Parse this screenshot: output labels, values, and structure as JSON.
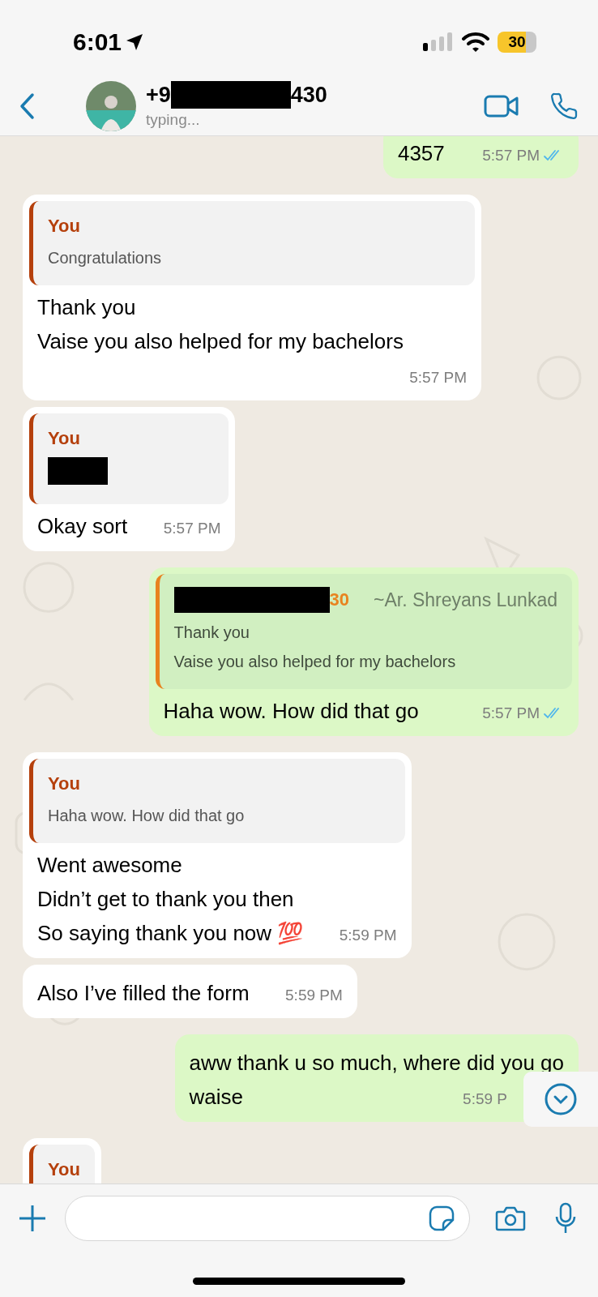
{
  "status_bar": {
    "time": "6:01",
    "battery": "30"
  },
  "header": {
    "title_start": "+9",
    "title_end": "430",
    "subtitle": "typing..."
  },
  "messages": [
    {
      "kind": "outgoing",
      "lines": [
        "4357"
      ],
      "time": "5:57 PM",
      "read": true
    },
    {
      "kind": "incoming",
      "quote": {
        "author": "You",
        "lines": [
          "Congratulations"
        ]
      },
      "lines": [
        "Thank you",
        "Vaise you also helped for my bachelors"
      ],
      "time": "5:57 PM"
    },
    {
      "kind": "incoming",
      "quote": {
        "author": "You",
        "redacted": true
      },
      "lines": [
        "Okay sort"
      ],
      "time": "5:57 PM"
    },
    {
      "kind": "outgoing",
      "quote": {
        "author": "30",
        "author_redacted": true,
        "sender_name": "~Ar. Shreyans Lunkad",
        "lines": [
          "Thank you",
          "Vaise you also helped for my bachelors"
        ]
      },
      "lines": [
        "Haha wow. How did that go"
      ],
      "time": "5:57 PM",
      "read": true
    },
    {
      "kind": "incoming",
      "quote": {
        "author": "You",
        "lines": [
          "Haha wow. How did that go"
        ]
      },
      "lines": [
        "Went awesome",
        "Didn’t get to thank you then",
        "So saying thank you now 💯"
      ],
      "time": "5:59 PM"
    },
    {
      "kind": "incoming",
      "lines": [
        "Also I’ve filled the form"
      ],
      "time": "5:59 PM"
    },
    {
      "kind": "outgoing",
      "lines": [
        "aww thank u so much, where did you go",
        "waise"
      ],
      "time": "5:59 P",
      "scroll_button_over": true
    },
    {
      "kind": "incoming",
      "quote": {
        "author": "You"
      }
    }
  ]
}
